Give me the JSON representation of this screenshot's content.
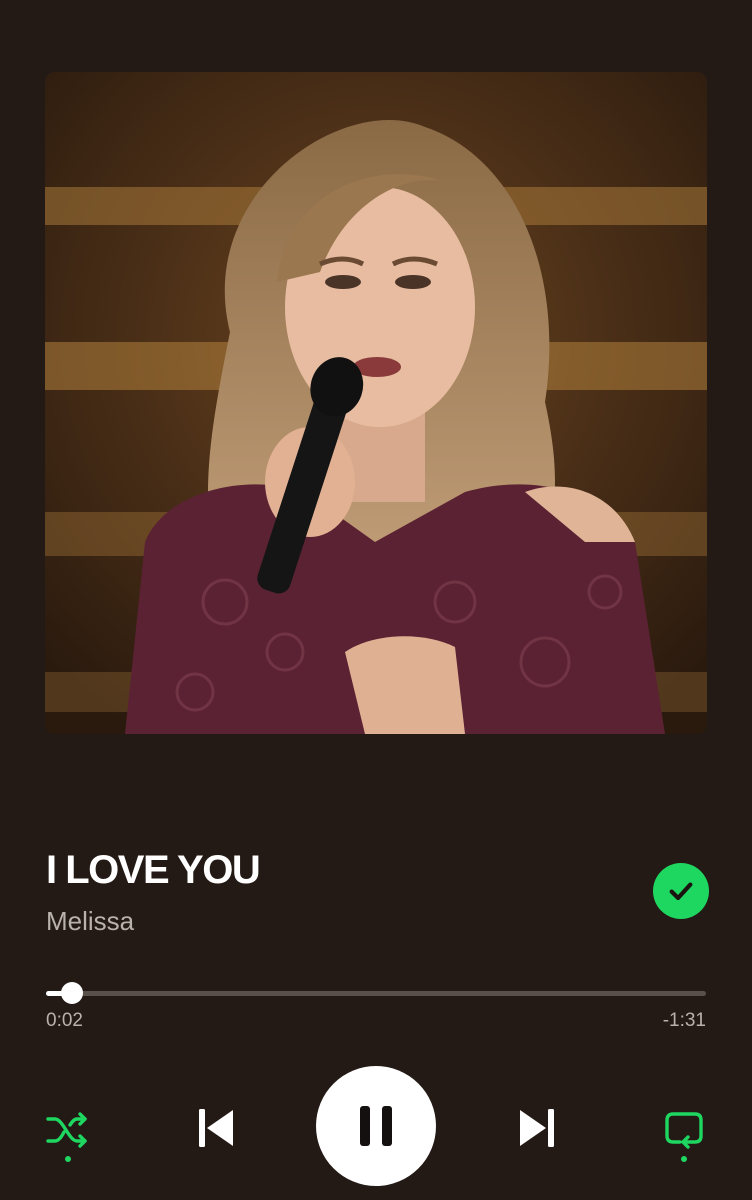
{
  "track": {
    "title": "I LOVE YOU",
    "artist": "Melissa",
    "liked": true
  },
  "artwork": {
    "alt": "Album artwork: a singer performing on stage holding a microphone"
  },
  "playback": {
    "elapsed": "0:02",
    "remaining": "-1:31",
    "progress_fraction": 0.04,
    "state": "playing",
    "shuffle_active": true,
    "repeat_active": true
  },
  "icons": {
    "liked": "check-icon",
    "shuffle": "shuffle-icon",
    "previous": "skip-previous-icon",
    "play_pause": "pause-icon",
    "next": "skip-next-icon",
    "repeat": "repeat-icon"
  },
  "colors": {
    "background": "#231915",
    "accent": "#1ed760",
    "secondary_text": "#b9b1ac",
    "progress_track": "#5a504b"
  }
}
